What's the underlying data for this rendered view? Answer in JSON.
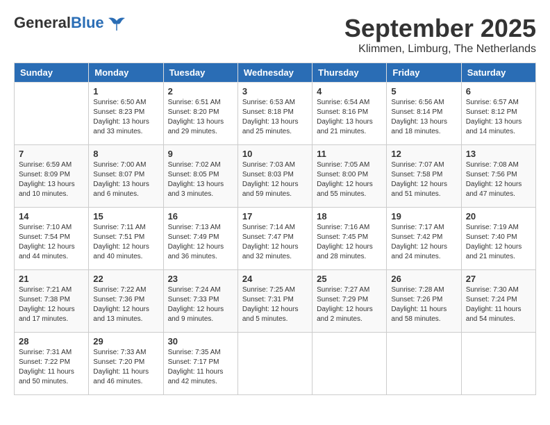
{
  "header": {
    "logo": {
      "general": "General",
      "blue": "Blue"
    },
    "title": "September 2025",
    "location": "Klimmen, Limburg, The Netherlands"
  },
  "weekdays": [
    "Sunday",
    "Monday",
    "Tuesday",
    "Wednesday",
    "Thursday",
    "Friday",
    "Saturday"
  ],
  "weeks": [
    [
      {
        "day": "",
        "info": ""
      },
      {
        "day": "1",
        "info": "Sunrise: 6:50 AM\nSunset: 8:23 PM\nDaylight: 13 hours\nand 33 minutes."
      },
      {
        "day": "2",
        "info": "Sunrise: 6:51 AM\nSunset: 8:20 PM\nDaylight: 13 hours\nand 29 minutes."
      },
      {
        "day": "3",
        "info": "Sunrise: 6:53 AM\nSunset: 8:18 PM\nDaylight: 13 hours\nand 25 minutes."
      },
      {
        "day": "4",
        "info": "Sunrise: 6:54 AM\nSunset: 8:16 PM\nDaylight: 13 hours\nand 21 minutes."
      },
      {
        "day": "5",
        "info": "Sunrise: 6:56 AM\nSunset: 8:14 PM\nDaylight: 13 hours\nand 18 minutes."
      },
      {
        "day": "6",
        "info": "Sunrise: 6:57 AM\nSunset: 8:12 PM\nDaylight: 13 hours\nand 14 minutes."
      }
    ],
    [
      {
        "day": "7",
        "info": "Sunrise: 6:59 AM\nSunset: 8:09 PM\nDaylight: 13 hours\nand 10 minutes."
      },
      {
        "day": "8",
        "info": "Sunrise: 7:00 AM\nSunset: 8:07 PM\nDaylight: 13 hours\nand 6 minutes."
      },
      {
        "day": "9",
        "info": "Sunrise: 7:02 AM\nSunset: 8:05 PM\nDaylight: 13 hours\nand 3 minutes."
      },
      {
        "day": "10",
        "info": "Sunrise: 7:03 AM\nSunset: 8:03 PM\nDaylight: 12 hours\nand 59 minutes."
      },
      {
        "day": "11",
        "info": "Sunrise: 7:05 AM\nSunset: 8:00 PM\nDaylight: 12 hours\nand 55 minutes."
      },
      {
        "day": "12",
        "info": "Sunrise: 7:07 AM\nSunset: 7:58 PM\nDaylight: 12 hours\nand 51 minutes."
      },
      {
        "day": "13",
        "info": "Sunrise: 7:08 AM\nSunset: 7:56 PM\nDaylight: 12 hours\nand 47 minutes."
      }
    ],
    [
      {
        "day": "14",
        "info": "Sunrise: 7:10 AM\nSunset: 7:54 PM\nDaylight: 12 hours\nand 44 minutes."
      },
      {
        "day": "15",
        "info": "Sunrise: 7:11 AM\nSunset: 7:51 PM\nDaylight: 12 hours\nand 40 minutes."
      },
      {
        "day": "16",
        "info": "Sunrise: 7:13 AM\nSunset: 7:49 PM\nDaylight: 12 hours\nand 36 minutes."
      },
      {
        "day": "17",
        "info": "Sunrise: 7:14 AM\nSunset: 7:47 PM\nDaylight: 12 hours\nand 32 minutes."
      },
      {
        "day": "18",
        "info": "Sunrise: 7:16 AM\nSunset: 7:45 PM\nDaylight: 12 hours\nand 28 minutes."
      },
      {
        "day": "19",
        "info": "Sunrise: 7:17 AM\nSunset: 7:42 PM\nDaylight: 12 hours\nand 24 minutes."
      },
      {
        "day": "20",
        "info": "Sunrise: 7:19 AM\nSunset: 7:40 PM\nDaylight: 12 hours\nand 21 minutes."
      }
    ],
    [
      {
        "day": "21",
        "info": "Sunrise: 7:21 AM\nSunset: 7:38 PM\nDaylight: 12 hours\nand 17 minutes."
      },
      {
        "day": "22",
        "info": "Sunrise: 7:22 AM\nSunset: 7:36 PM\nDaylight: 12 hours\nand 13 minutes."
      },
      {
        "day": "23",
        "info": "Sunrise: 7:24 AM\nSunset: 7:33 PM\nDaylight: 12 hours\nand 9 minutes."
      },
      {
        "day": "24",
        "info": "Sunrise: 7:25 AM\nSunset: 7:31 PM\nDaylight: 12 hours\nand 5 minutes."
      },
      {
        "day": "25",
        "info": "Sunrise: 7:27 AM\nSunset: 7:29 PM\nDaylight: 12 hours\nand 2 minutes."
      },
      {
        "day": "26",
        "info": "Sunrise: 7:28 AM\nSunset: 7:26 PM\nDaylight: 11 hours\nand 58 minutes."
      },
      {
        "day": "27",
        "info": "Sunrise: 7:30 AM\nSunset: 7:24 PM\nDaylight: 11 hours\nand 54 minutes."
      }
    ],
    [
      {
        "day": "28",
        "info": "Sunrise: 7:31 AM\nSunset: 7:22 PM\nDaylight: 11 hours\nand 50 minutes."
      },
      {
        "day": "29",
        "info": "Sunrise: 7:33 AM\nSunset: 7:20 PM\nDaylight: 11 hours\nand 46 minutes."
      },
      {
        "day": "30",
        "info": "Sunrise: 7:35 AM\nSunset: 7:17 PM\nDaylight: 11 hours\nand 42 minutes."
      },
      {
        "day": "",
        "info": ""
      },
      {
        "day": "",
        "info": ""
      },
      {
        "day": "",
        "info": ""
      },
      {
        "day": "",
        "info": ""
      }
    ]
  ]
}
